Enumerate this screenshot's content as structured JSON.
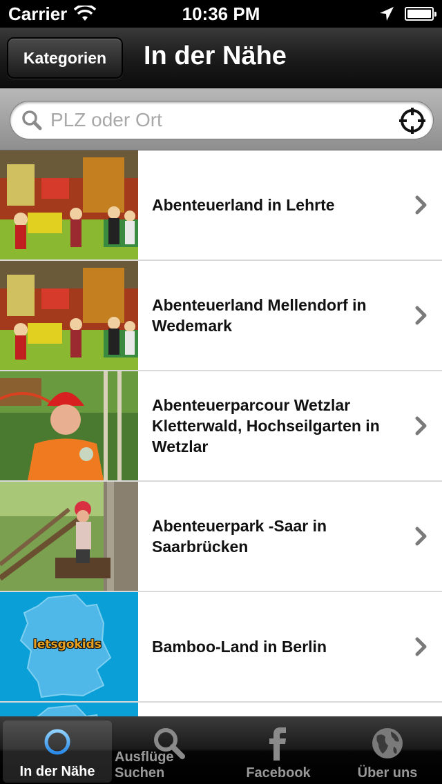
{
  "status": {
    "carrier": "Carrier",
    "time": "10:36 PM"
  },
  "nav": {
    "back_label": "Kategorien",
    "title": "In der Nähe"
  },
  "search": {
    "placeholder": "PLZ oder Ort",
    "value": ""
  },
  "list": {
    "items": [
      {
        "title": "Abenteuerland in Lehrte",
        "thumb": "playground-photo"
      },
      {
        "title": "Abenteuerland Mellendorf in Wedemark",
        "thumb": "playground-photo"
      },
      {
        "title": "Abenteuerparcour Wetzlar Kletterwald, Hochseilgarten in Wetzlar",
        "thumb": "climbing-kid-photo"
      },
      {
        "title": "Abenteuerpark -Saar in Saarbrücken",
        "thumb": "climbing-forest-photo"
      },
      {
        "title": "Bamboo-Land in Berlin",
        "thumb": "letsgokids-map-logo",
        "logo_text": "letsgokids"
      }
    ]
  },
  "tabs": [
    {
      "label": "In der Nähe",
      "icon": "crosshair-icon",
      "active": true
    },
    {
      "label": "Ausflüge Suchen",
      "icon": "search-icon",
      "active": false
    },
    {
      "label": "Facebook",
      "icon": "facebook-icon",
      "active": false
    },
    {
      "label": "Über uns",
      "icon": "globe-icon",
      "active": false
    }
  ],
  "colors": {
    "map_blue": "#0b9fd8",
    "tab_active_icon": "#5ab0ff"
  }
}
